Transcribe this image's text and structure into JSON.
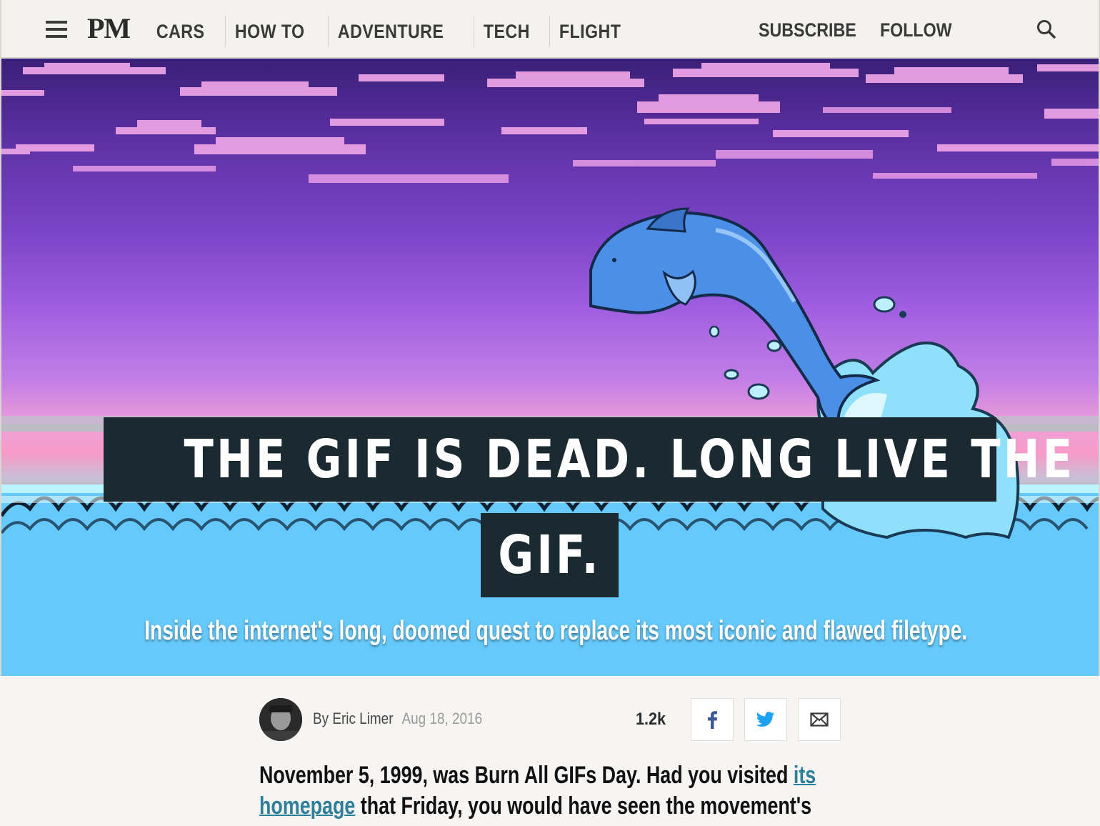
{
  "nav": {
    "logo": "PM",
    "links": [
      "CARS",
      "HOW TO",
      "ADVENTURE",
      "TECH",
      "FLIGHT"
    ],
    "subscribe": "SUBSCRIBE",
    "follow": "FOLLOW",
    "icons": {
      "menu": "hamburger-menu-icon",
      "search": "search-icon"
    }
  },
  "hero": {
    "headline_line1": "THE GIF IS DEAD. LONG LIVE THE",
    "headline_line2": "GIF.",
    "dek": "Inside the internet's long, doomed quest to replace its most iconic and flawed filetype."
  },
  "byline": {
    "by": "By ",
    "author": "Eric Limer",
    "date": "Aug 18, 2016",
    "share_count": "1.2k",
    "share_icons": [
      "facebook-icon",
      "twitter-icon",
      "email-icon"
    ]
  },
  "article": {
    "line1_before": "November 5, 1999, was Burn All GIFs Day. Had you visited ",
    "line1_link": "its",
    "line2_link": "homepage",
    "line2_after": " that Friday, you would have seen the movement's"
  },
  "colors": {
    "headline_bg": "#1b2a31",
    "link": "#2d7f9a",
    "facebook": "#3b5998",
    "twitter": "#1da1f2",
    "sea": "#65c9fb"
  }
}
